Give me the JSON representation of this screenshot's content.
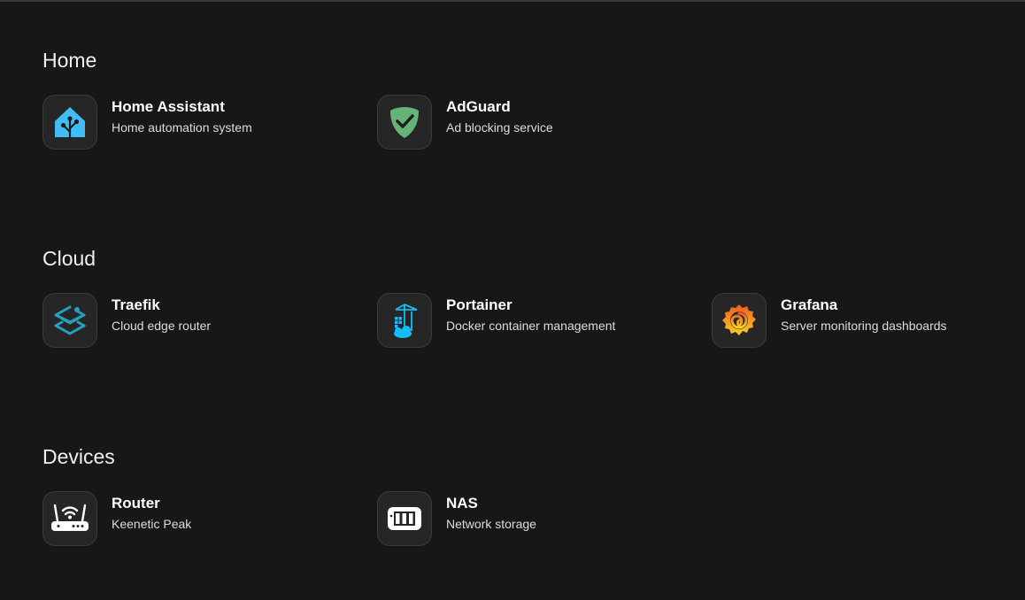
{
  "sections": [
    {
      "title": "Home",
      "items": [
        {
          "name": "Home Assistant",
          "description": "Home automation system",
          "icon": "home-assistant-icon"
        },
        {
          "name": "AdGuard",
          "description": "Ad blocking service",
          "icon": "adguard-shield-icon"
        }
      ]
    },
    {
      "title": "Cloud",
      "items": [
        {
          "name": "Traefik",
          "description": "Cloud edge router",
          "icon": "traefik-icon"
        },
        {
          "name": "Portainer",
          "description": "Docker container management",
          "icon": "portainer-icon"
        },
        {
          "name": "Grafana",
          "description": "Server monitoring dashboards",
          "icon": "grafana-icon"
        }
      ]
    },
    {
      "title": "Devices",
      "items": [
        {
          "name": "Router",
          "description": "Keenetic Peak",
          "icon": "router-icon"
        },
        {
          "name": "NAS",
          "description": "Network storage",
          "icon": "nas-icon"
        }
      ]
    }
  ],
  "colors": {
    "background": "#171717",
    "tile_bg": "#262626",
    "home_assistant_blue": "#41bdf5",
    "adguard_green": "#67b279",
    "traefik_blue": "#24a1c1",
    "portainer_blue": "#13bef9",
    "grafana_orange": "#f46800"
  }
}
